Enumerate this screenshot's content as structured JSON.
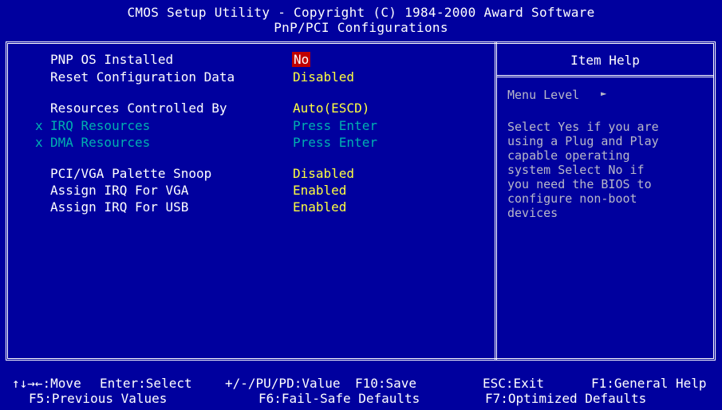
{
  "header": {
    "line1": "CMOS Setup Utility - Copyright (C) 1984-2000 Award Software",
    "line2": "PnP/PCI Configurations"
  },
  "settings": [
    {
      "label": "PNP OS Installed",
      "value": "No",
      "disabled": false,
      "selected": true
    },
    {
      "label": "Reset Configuration Data",
      "value": "Disabled",
      "disabled": false,
      "selected": false
    },
    {
      "label": "Resources Controlled By",
      "value": "Auto(ESCD)",
      "disabled": false,
      "selected": false
    },
    {
      "label": "IRQ Resources",
      "value": "Press Enter",
      "disabled": true,
      "selected": false,
      "mark": "x"
    },
    {
      "label": "DMA Resources",
      "value": "Press Enter",
      "disabled": true,
      "selected": false,
      "mark": "x"
    },
    {
      "label": "PCI/VGA Palette Snoop",
      "value": "Disabled",
      "disabled": false,
      "selected": false
    },
    {
      "label": "Assign IRQ For VGA",
      "value": "Enabled",
      "disabled": false,
      "selected": false
    },
    {
      "label": "Assign IRQ For USB",
      "value": "Enabled",
      "disabled": false,
      "selected": false
    }
  ],
  "help": {
    "title": "Item Help",
    "menu_level": "Menu Level",
    "menu_arrow": "►",
    "lines": [
      "Select Yes if you are",
      "using a Plug and Play",
      "capable operating",
      "system Select No if",
      "you need the BIOS to",
      "configure non-boot",
      "devices"
    ]
  },
  "footer": {
    "move": "↑↓→←:Move",
    "select": "Enter:Select",
    "value": "+/-/PU/PD:Value",
    "save": "F10:Save",
    "exit": "ESC:Exit",
    "general_help": "F1:General Help",
    "previous": "F5:Previous Values",
    "failsafe": "F6:Fail-Safe Defaults",
    "optimized": "F7:Optimized Defaults"
  },
  "colors": {
    "background": "#00009e",
    "value": "#ffff40",
    "disabled": "#00b0b0",
    "selection": "#c00000",
    "help_text": "#b8b8c8"
  }
}
